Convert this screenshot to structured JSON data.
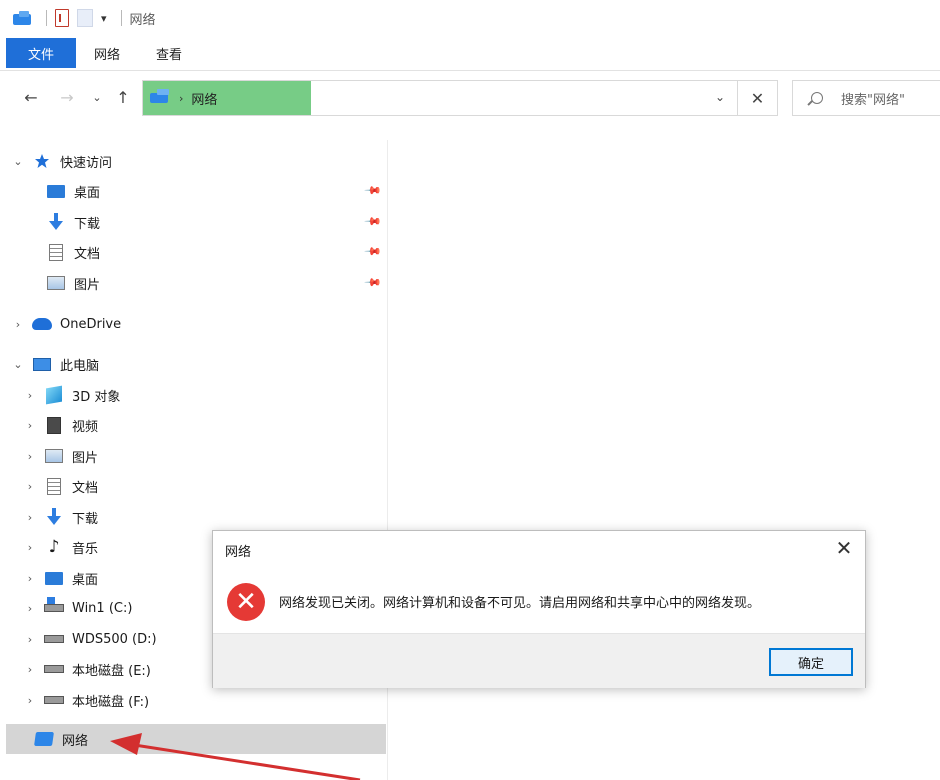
{
  "window": {
    "title": "网络"
  },
  "ribbon": {
    "tabs": [
      "文件",
      "网络",
      "查看"
    ]
  },
  "address": {
    "path": "网络"
  },
  "search": {
    "placeholder": "搜索\"网络\""
  },
  "sidebar": {
    "quick_access": {
      "label": "快速访问",
      "items": [
        "桌面",
        "下载",
        "文档",
        "图片"
      ]
    },
    "onedrive": "OneDrive",
    "this_pc": {
      "label": "此电脑",
      "items": [
        "3D 对象",
        "视频",
        "图片",
        "文档",
        "下载",
        "音乐",
        "桌面",
        "Win1 (C:)",
        "WDS500 (D:)",
        "本地磁盘 (E:)",
        "本地磁盘 (F:)"
      ]
    },
    "network": "网络"
  },
  "dialog": {
    "title": "网络",
    "message": "网络发现已关闭。网络计算机和设备不可见。请启用网络和共享中心中的网络发现。",
    "ok_label": "确定"
  },
  "colors": {
    "accent": "#1f6fd8",
    "address_highlight": "#77cc86",
    "error": "#e53935",
    "annotation_arrow": "#d32f2f"
  }
}
